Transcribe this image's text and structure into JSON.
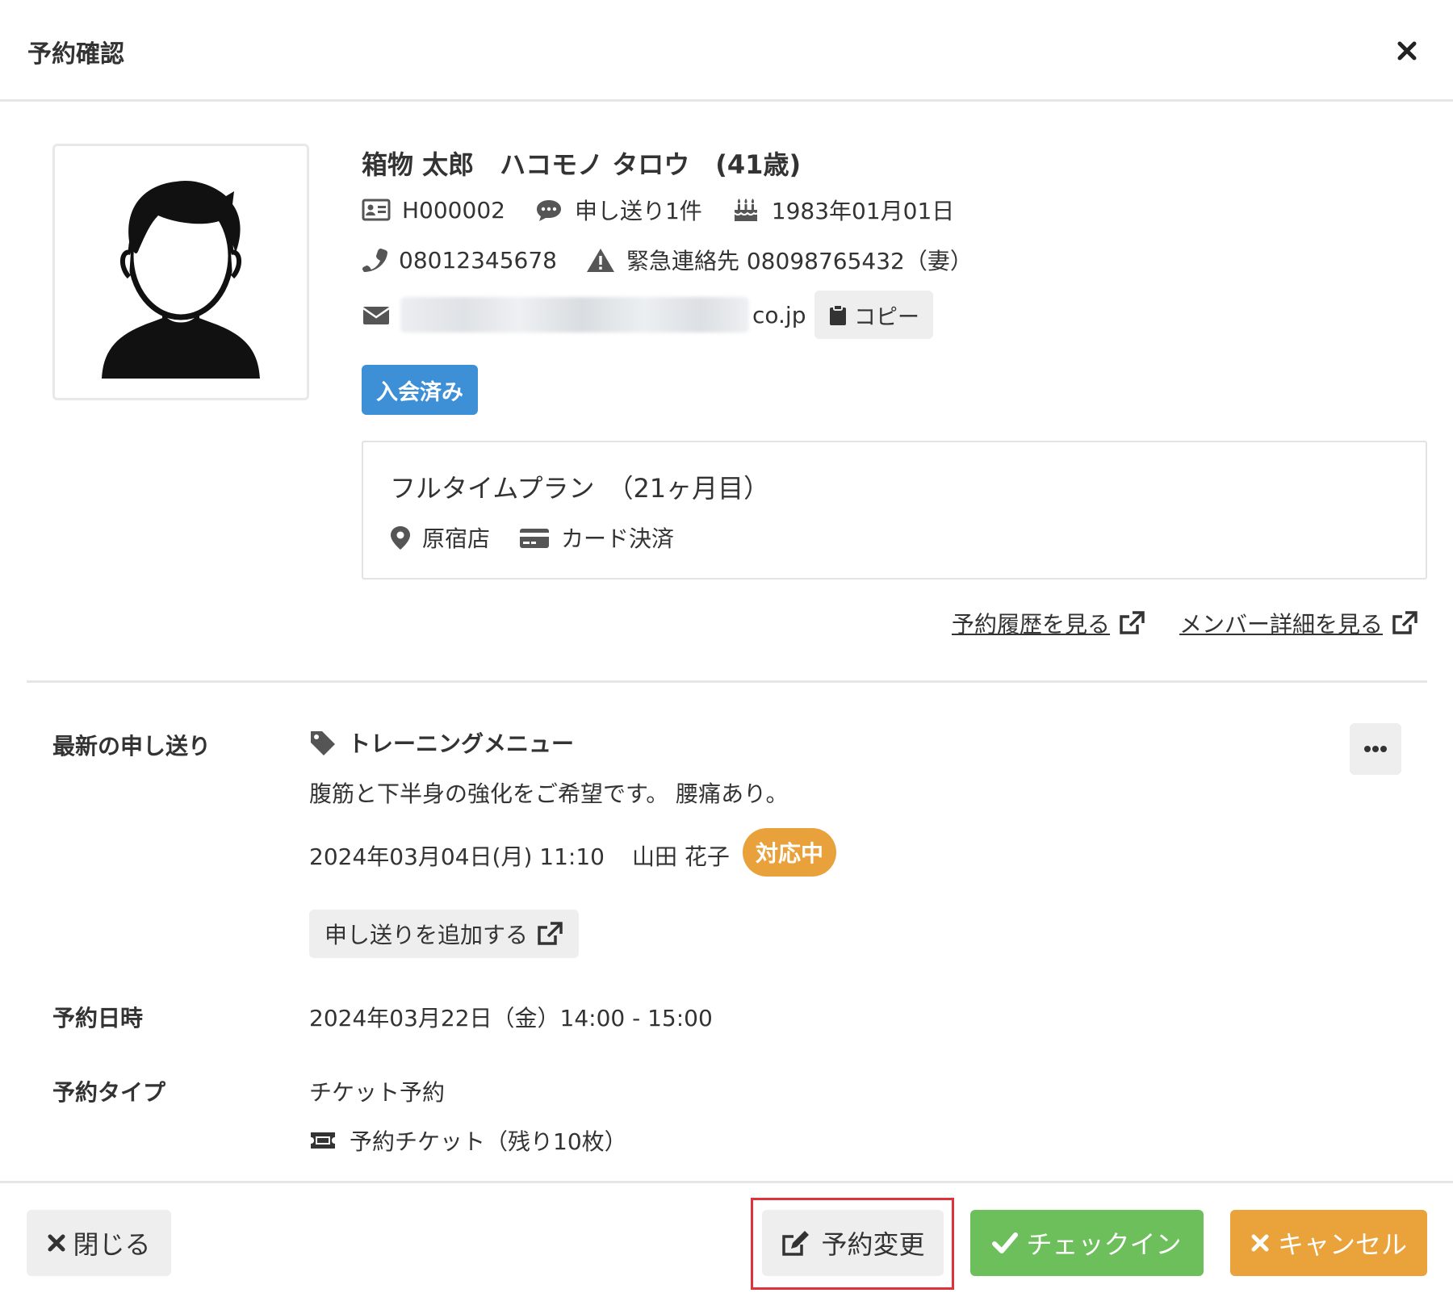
{
  "dialog": {
    "title": "予約確認",
    "close_icon": "close-icon"
  },
  "member": {
    "name": "箱物 太郎　ハコモノ タロウ　(41歳)",
    "id": "H000002",
    "notes_count": "申し送り1件",
    "birthday": "1983年01月01日",
    "phone": "08012345678",
    "emergency": "緊急連絡先 08098765432（妻）",
    "email_suffix": "co.jp",
    "copy_label": "コピー",
    "status_badge": "入会済み",
    "status_color": "#3d8fd6"
  },
  "plan": {
    "name": "フルタイムプラン　（21ヶ月目）",
    "store": "原宿店",
    "payment": "カード決済"
  },
  "links": {
    "history": "予約履歴を見る",
    "member_detail": "メンバー詳細を見る"
  },
  "latest_note": {
    "label": "最新の申し送り",
    "tag": "トレーニングメニュー",
    "body": "腹筋と下半身の強化をご希望です。 腰痛あり。",
    "datetime": "2024年03月04日(月) 11:10",
    "author": "山田 花子",
    "status": "対応中",
    "status_color": "#e9a23b",
    "add_label": "申し送りを追加する"
  },
  "reservation": {
    "datetime_label": "予約日時",
    "datetime": "2024年03月22日（金）14:00 - 15:00",
    "type_label": "予約タイプ",
    "type": "チケット予約",
    "ticket": "予約チケット（残り10枚）"
  },
  "footer": {
    "close": "閉じる",
    "change": "予約変更",
    "checkin": "チェックイン",
    "cancel": "キャンセル",
    "checkin_color": "#6cbf5b",
    "cancel_color": "#eaa23b",
    "highlight_color": "#e0323b"
  }
}
